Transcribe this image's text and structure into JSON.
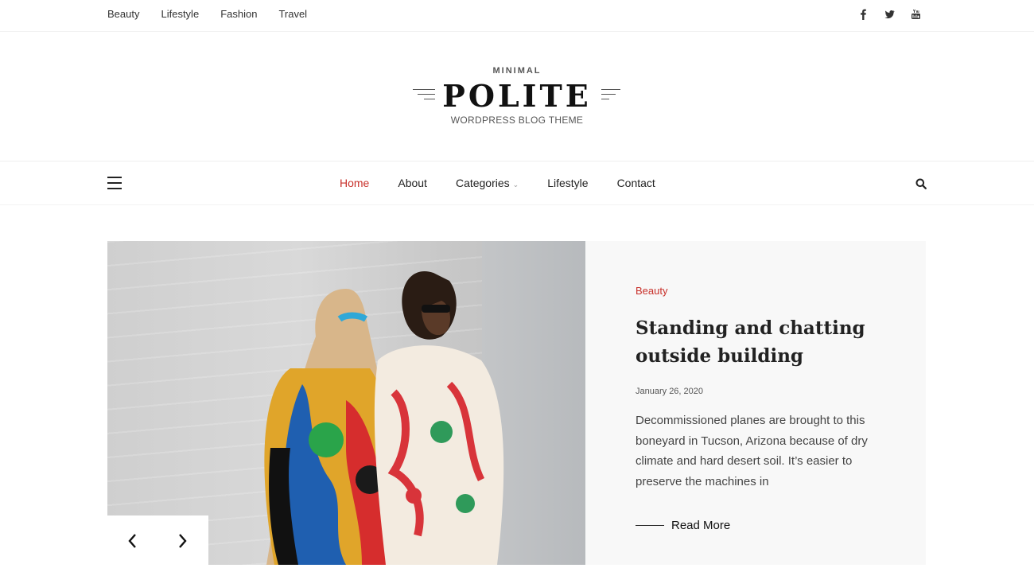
{
  "top_nav": [
    "Beauty",
    "Lifestyle",
    "Fashion",
    "Travel"
  ],
  "social_icons": [
    "facebook-icon",
    "twitter-icon",
    "youtube-icon"
  ],
  "logo": {
    "tagline_top": "MINIMAL",
    "name": "POLITE",
    "tagline_bottom": "WORDPRESS BLOG THEME"
  },
  "main_nav": {
    "items": [
      "Home",
      "About",
      "Categories",
      "Lifestyle",
      "Contact"
    ],
    "active": "Home",
    "active_color": "#c8302a"
  },
  "slide": {
    "category": "Beauty",
    "title": "Standing and chatting outside building",
    "date": "January 26, 2020",
    "excerpt": "Decommissioned planes are brought to this boneyard in Tucson, Arizona because of dry climate and hard desert soil. It’s easier to preserve the machines in",
    "read_more": "Read More"
  }
}
